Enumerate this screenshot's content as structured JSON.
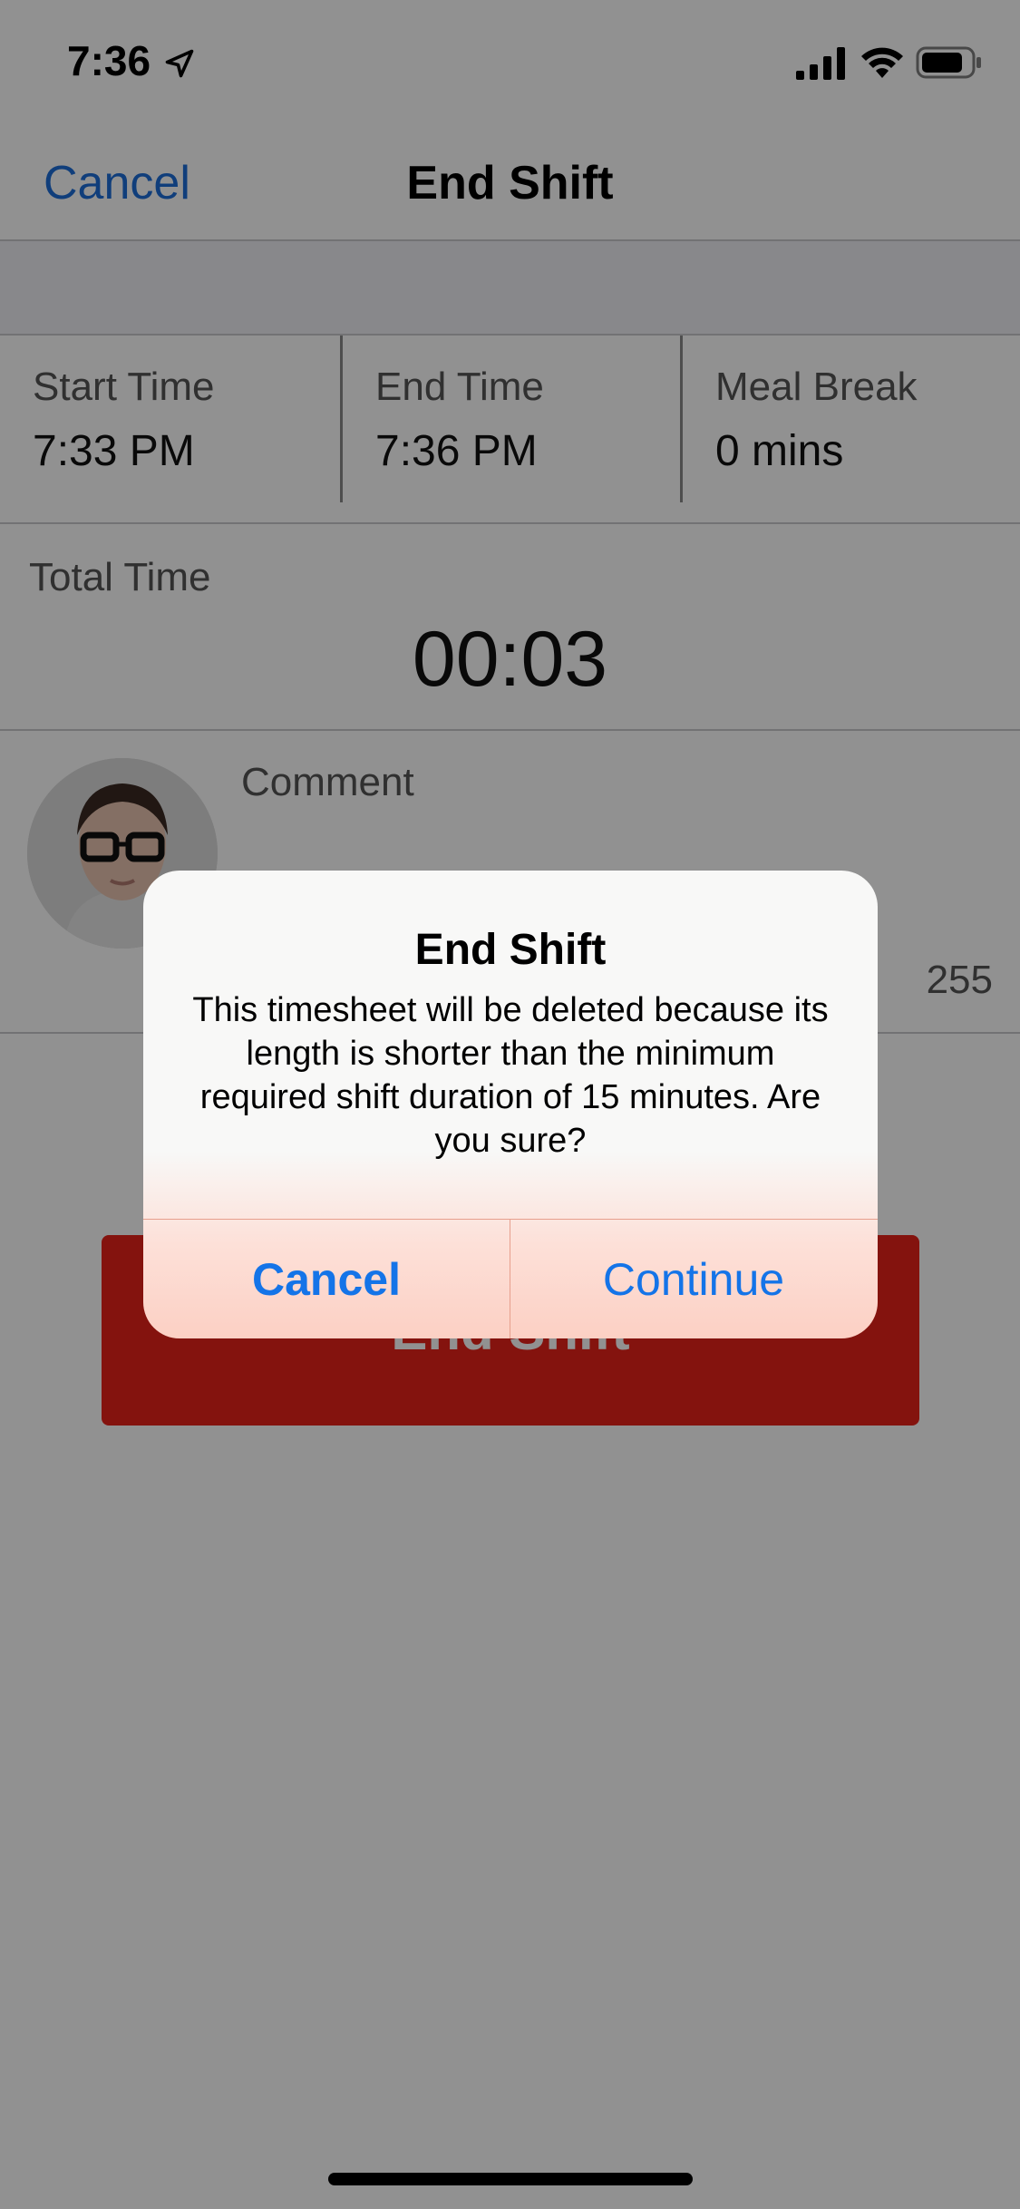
{
  "status_bar": {
    "time": "7:36",
    "icons": [
      "location-arrow-icon",
      "cellular-signal-icon",
      "wifi-icon",
      "battery-icon"
    ]
  },
  "nav": {
    "cancel_label": "Cancel",
    "title": "End Shift"
  },
  "times": [
    {
      "label": "Start Time",
      "value": "7:33 PM"
    },
    {
      "label": "End Time",
      "value": "7:36 PM"
    },
    {
      "label": "Meal Break",
      "value": "0 mins"
    }
  ],
  "total": {
    "label": "Total Time",
    "value": "00:03"
  },
  "comment": {
    "label": "Comment",
    "remaining_chars": "255"
  },
  "end_shift_button": {
    "label": "End Shift"
  },
  "alert": {
    "title": "End Shift",
    "message": "This timesheet will be deleted because its length is shorter than the minimum required shift duration of 15 minutes. Are you sure?",
    "cancel_label": "Cancel",
    "continue_label": "Continue"
  },
  "colors": {
    "accent_blue": "#1474e8",
    "end_shift_red": "#e8221a",
    "dim_overlay": "rgba(0,0,0,0.43)"
  }
}
